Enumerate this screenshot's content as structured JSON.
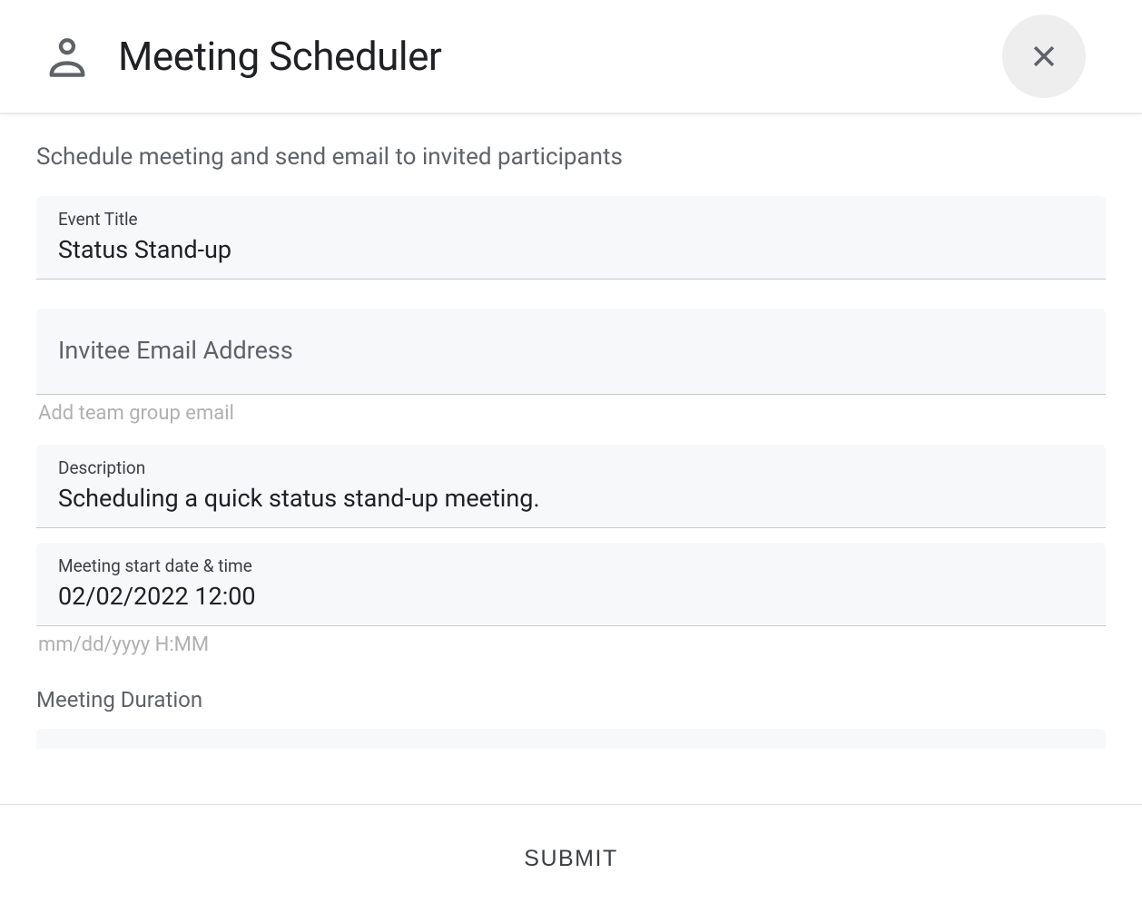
{
  "header": {
    "title": "Meeting Scheduler"
  },
  "subtitle": "Schedule meeting and send email to invited participants",
  "fields": {
    "event_title": {
      "label": "Event Title",
      "value": "Status Stand-up"
    },
    "invitee": {
      "label": "Invitee Email Address",
      "value": "",
      "helper": "Add team group email"
    },
    "description": {
      "label": "Description",
      "value": "Scheduling a quick status stand-up meeting."
    },
    "start": {
      "label": "Meeting start date & time",
      "value": "02/02/2022 12:00",
      "helper": "mm/dd/yyyy H:MM"
    },
    "duration": {
      "label": "Meeting Duration"
    }
  },
  "footer": {
    "submit_label": "SUBMIT"
  }
}
